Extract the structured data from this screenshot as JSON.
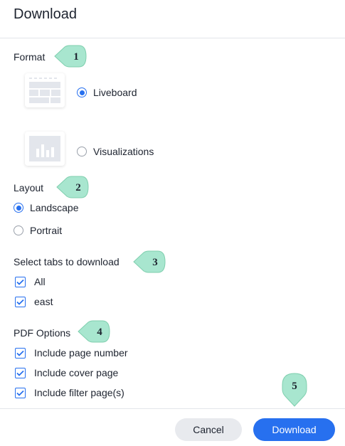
{
  "dialog": {
    "title": "Download"
  },
  "format": {
    "label": "Format",
    "options": [
      {
        "label": "Liveboard",
        "selected": true,
        "icon": "liveboard-thumbnail-icon"
      },
      {
        "label": "Visualizations",
        "selected": false,
        "icon": "bar-chart-thumbnail-icon"
      }
    ]
  },
  "layout": {
    "label": "Layout",
    "options": [
      {
        "label": "Landscape",
        "selected": true
      },
      {
        "label": "Portrait",
        "selected": false
      }
    ]
  },
  "tabs": {
    "label": "Select tabs to download",
    "items": [
      {
        "label": "All",
        "checked": true
      },
      {
        "label": "east",
        "checked": true
      }
    ]
  },
  "pdf_options": {
    "label": "PDF Options",
    "items": [
      {
        "label": "Include page number",
        "checked": true
      },
      {
        "label": "Include cover page",
        "checked": true
      },
      {
        "label": "Include filter page(s)",
        "checked": true
      }
    ]
  },
  "footer": {
    "cancel_label": "Cancel",
    "download_label": "Download"
  },
  "callouts": [
    "1",
    "2",
    "3",
    "4",
    "5"
  ],
  "colors": {
    "accent": "#2770ef",
    "callout": "#a8e6cf",
    "callout_border": "#7fcfae"
  }
}
